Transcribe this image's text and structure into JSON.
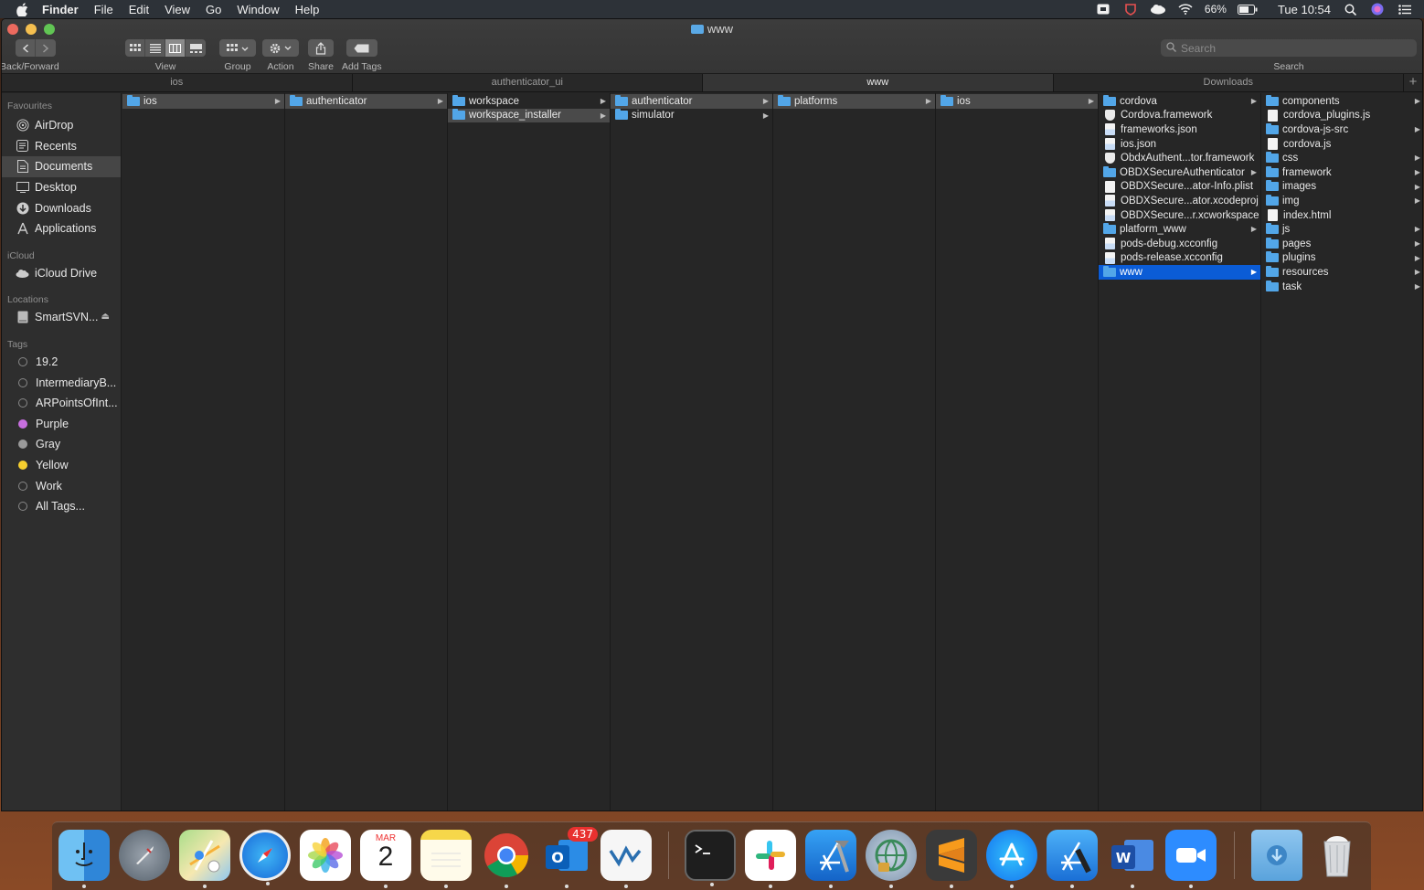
{
  "menubar": {
    "app_name": "Finder",
    "menus": [
      "File",
      "Edit",
      "View",
      "Go",
      "Window",
      "Help"
    ],
    "battery": "66%",
    "clock": "Tue 10:54"
  },
  "window": {
    "title": "www",
    "toolbar": {
      "back_forward": "Back/Forward",
      "view": "View",
      "group": "Group",
      "action": "Action",
      "share": "Share",
      "add_tags": "Add Tags",
      "search_placeholder": "Search",
      "search_caption": "Search"
    },
    "tabs": [
      "ios",
      "authenticator_ui",
      "www",
      "Downloads"
    ],
    "active_tab": "www"
  },
  "sidebar": {
    "favourites_header": "Favourites",
    "favourites": [
      {
        "label": "AirDrop",
        "icon": "airdrop-icon"
      },
      {
        "label": "Recents",
        "icon": "recents-icon"
      },
      {
        "label": "Documents",
        "icon": "documents-icon"
      },
      {
        "label": "Desktop",
        "icon": "desktop-icon"
      },
      {
        "label": "Downloads",
        "icon": "downloads-icon"
      },
      {
        "label": "Applications",
        "icon": "applications-icon"
      }
    ],
    "selected": "Documents",
    "icloud_header": "iCloud",
    "icloud": [
      {
        "label": "iCloud Drive",
        "icon": "cloud-icon"
      }
    ],
    "locations_header": "Locations",
    "locations": [
      {
        "label": "SmartSVN...",
        "icon": "disk-icon"
      }
    ],
    "tags_header": "Tags",
    "tags": [
      {
        "label": "19.2",
        "color": ""
      },
      {
        "label": "IntermediaryB...",
        "color": ""
      },
      {
        "label": "ARPointsOfInt...",
        "color": ""
      },
      {
        "label": "Purple",
        "color": "#c86fe0"
      },
      {
        "label": "Gray",
        "color": "#9a9a9a"
      },
      {
        "label": "Yellow",
        "color": "#f6cf2f"
      },
      {
        "label": "Work",
        "color": ""
      },
      {
        "label": "All Tags...",
        "color": ""
      }
    ]
  },
  "columns": [
    {
      "items": [
        {
          "name": "ios",
          "type": "folder",
          "arrow": true,
          "state": "inactive"
        }
      ]
    },
    {
      "items": [
        {
          "name": "authenticator",
          "type": "folder",
          "arrow": true,
          "state": "inactive"
        }
      ]
    },
    {
      "items": [
        {
          "name": "workspace",
          "type": "folder",
          "arrow": true,
          "state": ""
        },
        {
          "name": "workspace_installer",
          "type": "folder",
          "arrow": true,
          "state": "inactive"
        }
      ]
    },
    {
      "items": [
        {
          "name": "authenticator",
          "type": "folder",
          "arrow": true,
          "state": "inactive"
        },
        {
          "name": "simulator",
          "type": "folder",
          "arrow": true,
          "state": ""
        }
      ]
    },
    {
      "items": [
        {
          "name": "platforms",
          "type": "folder",
          "arrow": true,
          "state": "inactive"
        }
      ]
    },
    {
      "items": [
        {
          "name": "ios",
          "type": "folder",
          "arrow": true,
          "state": "inactive"
        }
      ]
    },
    {
      "items": [
        {
          "name": "cordova",
          "type": "folder",
          "arrow": true,
          "state": ""
        },
        {
          "name": "Cordova.framework",
          "type": "shield",
          "arrow": false,
          "state": ""
        },
        {
          "name": "frameworks.json",
          "type": "doc-blue",
          "arrow": false,
          "state": ""
        },
        {
          "name": "ios.json",
          "type": "doc-blue",
          "arrow": false,
          "state": ""
        },
        {
          "name": "ObdxAuthent...tor.framework",
          "type": "shield",
          "arrow": false,
          "state": ""
        },
        {
          "name": "OBDXSecureAuthenticator",
          "type": "folder",
          "arrow": true,
          "state": ""
        },
        {
          "name": "OBDXSecure...ator-Info.plist",
          "type": "doc",
          "arrow": false,
          "state": ""
        },
        {
          "name": "OBDXSecure...ator.xcodeproj",
          "type": "doc-blue",
          "arrow": false,
          "state": ""
        },
        {
          "name": "OBDXSecure...r.xcworkspace",
          "type": "doc-blue",
          "arrow": false,
          "state": ""
        },
        {
          "name": "platform_www",
          "type": "folder",
          "arrow": true,
          "state": ""
        },
        {
          "name": "pods-debug.xcconfig",
          "type": "doc-blue",
          "arrow": false,
          "state": ""
        },
        {
          "name": "pods-release.xcconfig",
          "type": "doc-blue",
          "arrow": false,
          "state": ""
        },
        {
          "name": "www",
          "type": "folder",
          "arrow": true,
          "state": "active"
        }
      ]
    },
    {
      "items": [
        {
          "name": "components",
          "type": "folder",
          "arrow": true,
          "state": ""
        },
        {
          "name": "cordova_plugins.js",
          "type": "doc",
          "arrow": false,
          "state": ""
        },
        {
          "name": "cordova-js-src",
          "type": "folder",
          "arrow": true,
          "state": ""
        },
        {
          "name": "cordova.js",
          "type": "doc",
          "arrow": false,
          "state": ""
        },
        {
          "name": "css",
          "type": "folder",
          "arrow": true,
          "state": ""
        },
        {
          "name": "framework",
          "type": "folder",
          "arrow": true,
          "state": ""
        },
        {
          "name": "images",
          "type": "folder",
          "arrow": true,
          "state": ""
        },
        {
          "name": "img",
          "type": "folder",
          "arrow": true,
          "state": ""
        },
        {
          "name": "index.html",
          "type": "doc",
          "arrow": false,
          "state": ""
        },
        {
          "name": "js",
          "type": "folder",
          "arrow": true,
          "state": ""
        },
        {
          "name": "pages",
          "type": "folder",
          "arrow": true,
          "state": ""
        },
        {
          "name": "plugins",
          "type": "folder",
          "arrow": true,
          "state": ""
        },
        {
          "name": "resources",
          "type": "folder",
          "arrow": true,
          "state": ""
        },
        {
          "name": "task",
          "type": "folder",
          "arrow": true,
          "state": ""
        }
      ]
    }
  ],
  "dock": {
    "calendar_month": "MAR",
    "calendar_day": "2",
    "outlook_badge": "437",
    "apps": [
      "finder-icon",
      "launchpad-icon",
      "maps-icon",
      "safari-icon",
      "photos-icon",
      "calendar-icon",
      "notes-icon",
      "chrome-icon",
      "outlook-icon",
      "smartsvn-icon",
      "terminal-icon",
      "slack-icon",
      "xcode-icon",
      "vpn-icon",
      "sublime-icon",
      "app-store-icon",
      "xcode-beta-icon",
      "word-icon",
      "zoom-icon",
      "downloads-stack-icon",
      "trash-icon"
    ]
  }
}
